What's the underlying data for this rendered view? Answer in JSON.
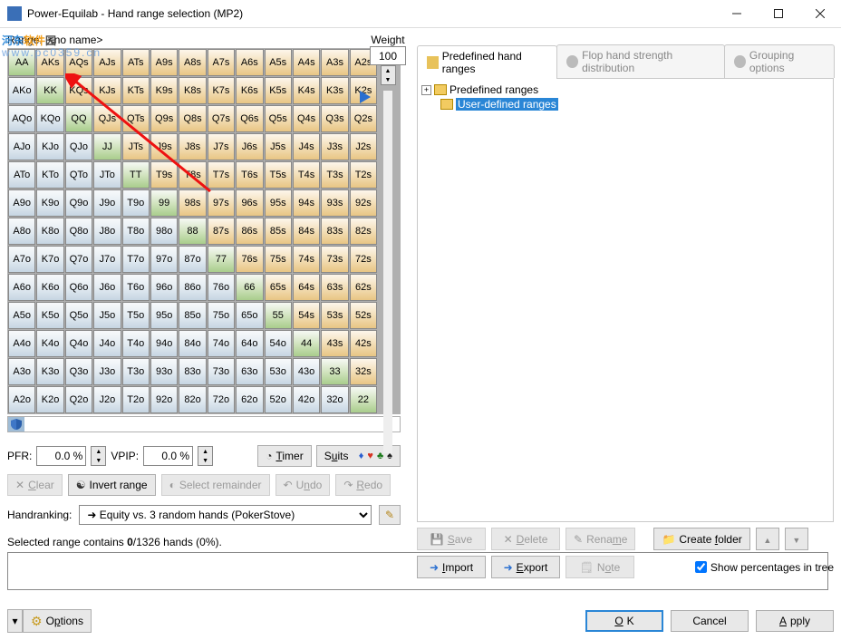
{
  "window": {
    "title": "Power-Equilab - Hand range selection (MP2)"
  },
  "watermark": {
    "brand_a": "河东",
    "brand_b": "软件",
    "brand_c": "园",
    "url": "www.pc0359.cn"
  },
  "range_row": {
    "label": "Range:",
    "name": "<no name>"
  },
  "weight": {
    "label": "Weight",
    "value": "100"
  },
  "ranks": [
    "A",
    "K",
    "Q",
    "J",
    "T",
    "9",
    "8",
    "7",
    "6",
    "5",
    "4",
    "3",
    "2"
  ],
  "pct": {
    "pfr_label": "PFR:",
    "pfr_value": "0.0 %",
    "vpip_label": "VPIP:",
    "vpip_value": "0.0 %",
    "timer": "Timer",
    "suits": "Suits"
  },
  "actions": {
    "clear": "Clear",
    "invert": "Invert range",
    "select_rem": "Select remainder",
    "undo": "Undo",
    "redo": "Redo"
  },
  "handranking": {
    "label": "Handranking:",
    "value": "Equity vs. 3 random hands (PokerStove)"
  },
  "selection_text": {
    "prefix": "Selected range contains ",
    "bold": "0",
    "suffix": "/1326 hands (0%)."
  },
  "tabs": {
    "t1": "Predefined hand ranges",
    "t2": "Flop hand strength distribution",
    "t3": "Grouping options"
  },
  "tree": {
    "root": "Predefined ranges",
    "user": "User-defined ranges"
  },
  "right_buttons": {
    "save": "Save",
    "delete": "Delete",
    "rename": "Rename",
    "create_folder": "Create folder",
    "import": "Import",
    "export": "Export",
    "note": "Note",
    "show_pct": "Show percentages in tree"
  },
  "footer": {
    "options": "Options",
    "ok": "OK",
    "cancel": "Cancel",
    "apply": "Apply"
  }
}
